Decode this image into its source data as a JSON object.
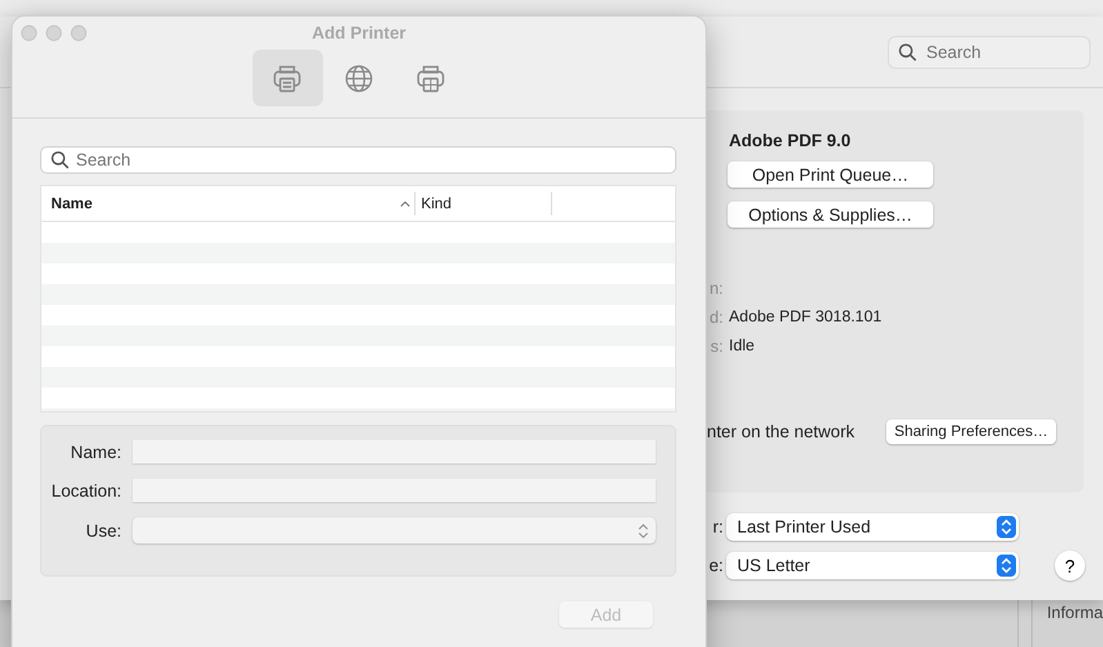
{
  "background_window": {
    "search": {
      "placeholder": "Search"
    },
    "printer_name": "Adobe PDF 9.0",
    "buttons": [
      "Open Print Queue…",
      "Options & Supplies…"
    ],
    "details": [
      {
        "label": "n:"
      },
      {
        "label": "d:",
        "value": "Adobe PDF 3018.101"
      },
      {
        "label": "s:",
        "value": "Idle"
      }
    ],
    "sharing_text": "nter on the network",
    "sharing_button": "Sharing Preferences…",
    "defaults": [
      {
        "label": "r:",
        "value": "Last Printer Used"
      },
      {
        "label": "e:",
        "value": "US Letter"
      }
    ],
    "help_button": "?"
  },
  "behind_text": "Informa",
  "add_printer": {
    "title": "Add Printer",
    "toolbar": [
      {
        "kind": "default",
        "selected": true
      },
      {
        "kind": "ip",
        "selected": false
      },
      {
        "kind": "windows",
        "selected": false
      }
    ],
    "search": {
      "placeholder": "Search"
    },
    "table": {
      "columns": [
        {
          "label": "Name",
          "sorted": true
        },
        {
          "label": "Kind",
          "sorted": false
        }
      ]
    },
    "form": [
      {
        "label": "Name:",
        "kind": "text"
      },
      {
        "label": "Location:",
        "kind": "text"
      },
      {
        "label": "Use:",
        "kind": "popup"
      }
    ],
    "add_button": {
      "label": "Add",
      "disabled": true
    }
  }
}
